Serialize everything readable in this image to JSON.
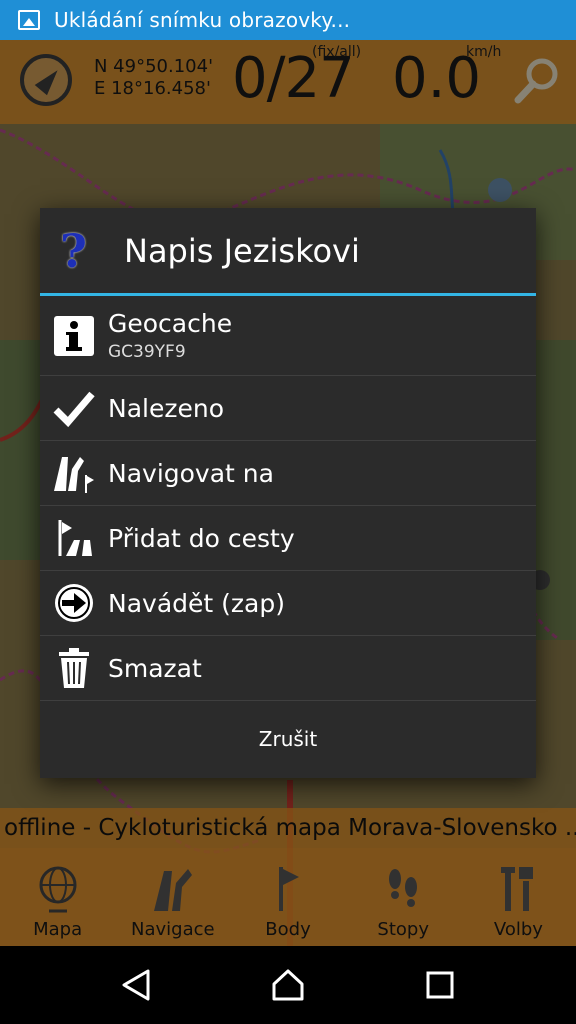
{
  "status_bar": {
    "notification_text": "Ukládání snímku obrazovky..."
  },
  "hud": {
    "latitude": "N 49°50.104'",
    "longitude": "E 18°16.458'",
    "satellites": "0/27",
    "satellites_unit": "(fix/all)",
    "speed": "0.0",
    "speed_unit": "km/h"
  },
  "map_title": "offline - Cykloturistická mapa Morava-Slovensko ...",
  "bottom_nav": [
    {
      "label": "Mapa",
      "icon": "globe-icon"
    },
    {
      "label": "Navigace",
      "icon": "road-icon"
    },
    {
      "label": "Body",
      "icon": "flag-icon"
    },
    {
      "label": "Stopy",
      "icon": "footprints-icon"
    },
    {
      "label": "Volby",
      "icon": "tools-icon"
    }
  ],
  "dialog": {
    "title": "Napis Jeziskovi",
    "items": [
      {
        "label": "Geocache",
        "sublabel": "GC39YF9",
        "icon": "info-icon"
      },
      {
        "label": "Nalezeno",
        "icon": "checkmark-icon"
      },
      {
        "label": "Navigovat na",
        "icon": "road-flag-icon"
      },
      {
        "label": "Přidat do cesty",
        "icon": "route-add-icon"
      },
      {
        "label": "Navádět (zap)",
        "icon": "arrow-circle-icon"
      },
      {
        "label": "Smazat",
        "icon": "trash-icon"
      }
    ],
    "cancel_label": "Zrušit"
  },
  "colors": {
    "status_bar": "#1f8fd6",
    "accent": "#33b5e5",
    "dialog_bg": "#2b2b2b",
    "hud_orange": "#e69128"
  }
}
